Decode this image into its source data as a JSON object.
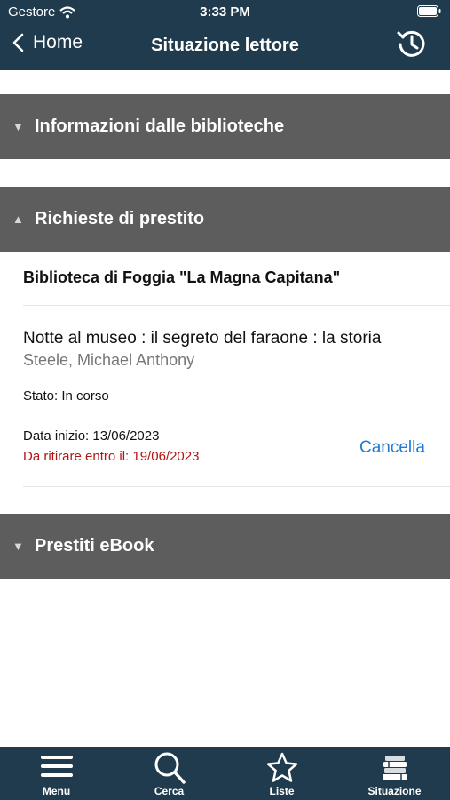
{
  "status_bar": {
    "carrier": "Gestore",
    "time": "3:33 PM"
  },
  "nav": {
    "back_label": "Home",
    "title": "Situazione lettore"
  },
  "sections": {
    "info": "Informazioni dalle biblioteche",
    "richieste": "Richieste di prestito",
    "ebook": "Prestiti eBook"
  },
  "request": {
    "library": "Biblioteca di Foggia \"La Magna Capitana\"",
    "book_title": "Notte al museo : il segreto del faraone : la storia",
    "author": "Steele, Michael Anthony",
    "stato": "Stato: In corso",
    "data_inizio": "Data inizio: 13/06/2023",
    "ritirare": "Da ritirare entro il: 19/06/2023",
    "cancel_label": "Cancella"
  },
  "tabs": [
    "Menu",
    "Cerca",
    "Liste",
    "Situazione"
  ],
  "colors": {
    "bar": "#1f3b4d",
    "section": "#5d5d5d",
    "accent": "#1e7bd4",
    "warning": "#b51414"
  }
}
